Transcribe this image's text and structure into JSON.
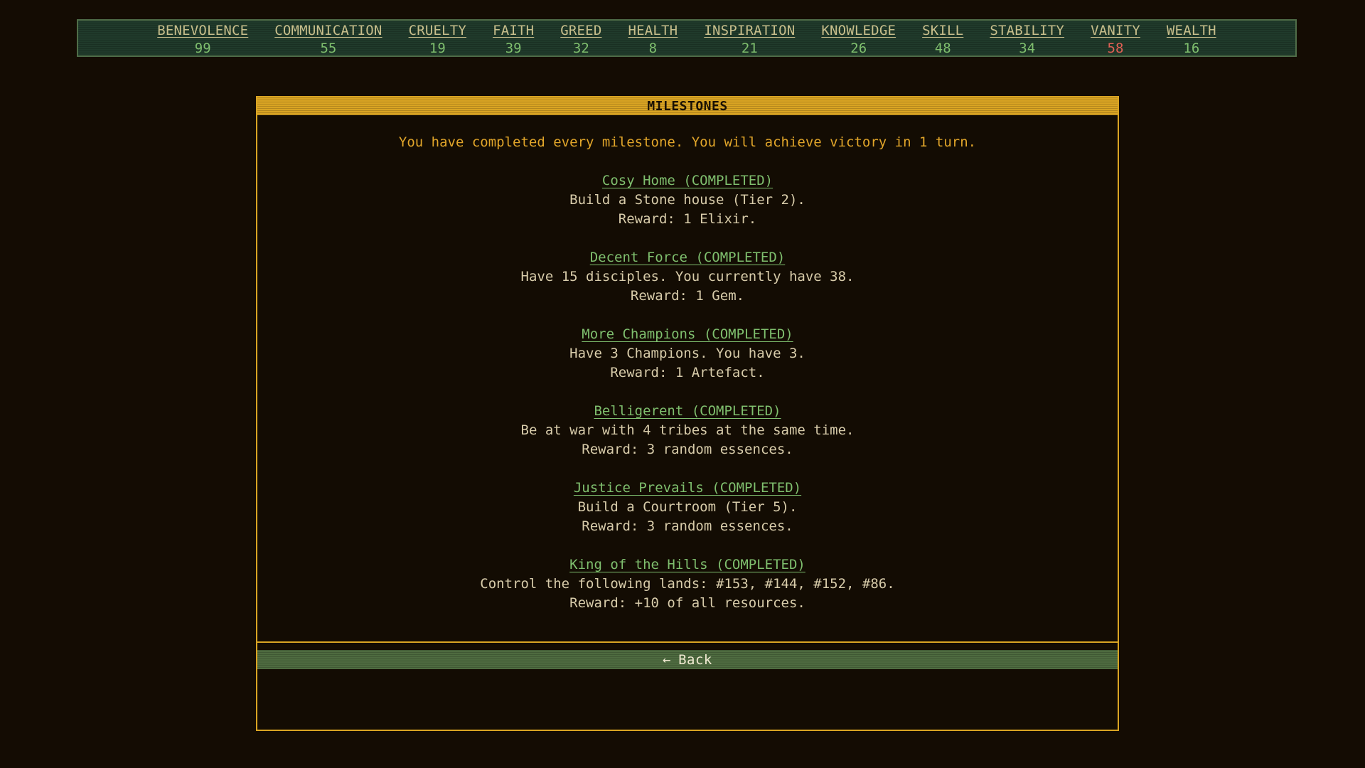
{
  "stats": [
    {
      "name": "BENEVOLENCE",
      "value": "99",
      "warn": false
    },
    {
      "name": "COMMUNICATION",
      "value": "55",
      "warn": false
    },
    {
      "name": "CRUELTY",
      "value": "19",
      "warn": false
    },
    {
      "name": "FAITH",
      "value": "39",
      "warn": false
    },
    {
      "name": "GREED",
      "value": "32",
      "warn": false
    },
    {
      "name": "HEALTH",
      "value": "8",
      "warn": false
    },
    {
      "name": "INSPIRATION",
      "value": "21",
      "warn": false
    },
    {
      "name": "KNOWLEDGE",
      "value": "26",
      "warn": false
    },
    {
      "name": "SKILL",
      "value": "48",
      "warn": false
    },
    {
      "name": "STABILITY",
      "value": "34",
      "warn": false
    },
    {
      "name": "VANITY",
      "value": "58",
      "warn": true
    },
    {
      "name": "WEALTH",
      "value": "16",
      "warn": false
    }
  ],
  "colors": {
    "background": "#140c03",
    "accent": "#d9a423",
    "positive": "#7fbf6e",
    "warning": "#e06055",
    "stats_bar": "#203a2b",
    "back_button": "#4e6b40"
  },
  "panel": {
    "title": "MILESTONES",
    "summary": "You have completed every milestone. You will achieve victory in 1 turn.",
    "back_icon": "left-arrow-icon",
    "back_arrow": "←",
    "back_label": "Back"
  },
  "milestones": [
    {
      "title": "Cosy Home (COMPLETED)",
      "desc": "Build a Stone house (Tier 2).",
      "reward": "Reward: 1 Elixir."
    },
    {
      "title": "Decent Force (COMPLETED)",
      "desc": "Have 15 disciples. You currently have 38.",
      "reward": "Reward: 1 Gem."
    },
    {
      "title": "More Champions (COMPLETED)",
      "desc": "Have 3 Champions. You have 3.",
      "reward": "Reward: 1 Artefact."
    },
    {
      "title": "Belligerent (COMPLETED)",
      "desc": "Be at war with 4 tribes at the same time.",
      "reward": "Reward: 3 random essences."
    },
    {
      "title": "Justice Prevails (COMPLETED)",
      "desc": "Build a Courtroom (Tier 5).",
      "reward": "Reward: 3 random essences."
    },
    {
      "title": "King of the Hills (COMPLETED)",
      "desc": "Control the following lands: #153, #144, #152, #86.",
      "reward": "Reward: +10 of all resources."
    }
  ]
}
